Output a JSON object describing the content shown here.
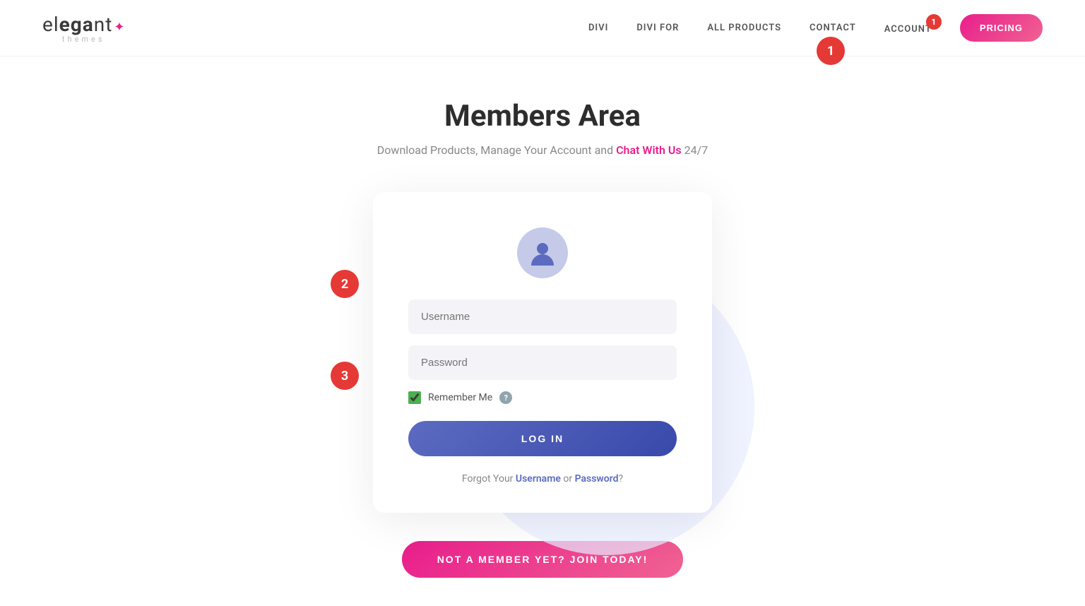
{
  "logo": {
    "brand": "elegant",
    "star": "✦",
    "sub": "themes"
  },
  "nav": {
    "links": [
      {
        "label": "DIVI",
        "id": "divi"
      },
      {
        "label": "DIVI FOR",
        "id": "divi-for"
      },
      {
        "label": "ALL PRODUCTS",
        "id": "all-products"
      },
      {
        "label": "CONTACT",
        "id": "contact"
      },
      {
        "label": "ACCOUNT",
        "id": "account"
      }
    ],
    "pricing_label": "PRICING",
    "account_badge": "1"
  },
  "hero": {
    "title": "Members Area",
    "subtitle_pre": "Download Products, Manage Your Account and ",
    "subtitle_link": "Chat With Us",
    "subtitle_post": " 24/7"
  },
  "form": {
    "username_placeholder": "Username",
    "password_placeholder": "Password",
    "remember_label": "Remember Me",
    "login_label": "LOG IN",
    "forgot_pre": "Forgot Your ",
    "forgot_username": "Username",
    "forgot_or": " or ",
    "forgot_password": "Password",
    "forgot_post": "?"
  },
  "join": {
    "label": "NOT A MEMBER YET? JOIN TODAY!"
  },
  "annotations": {
    "one": "1",
    "two": "2",
    "three": "3"
  }
}
